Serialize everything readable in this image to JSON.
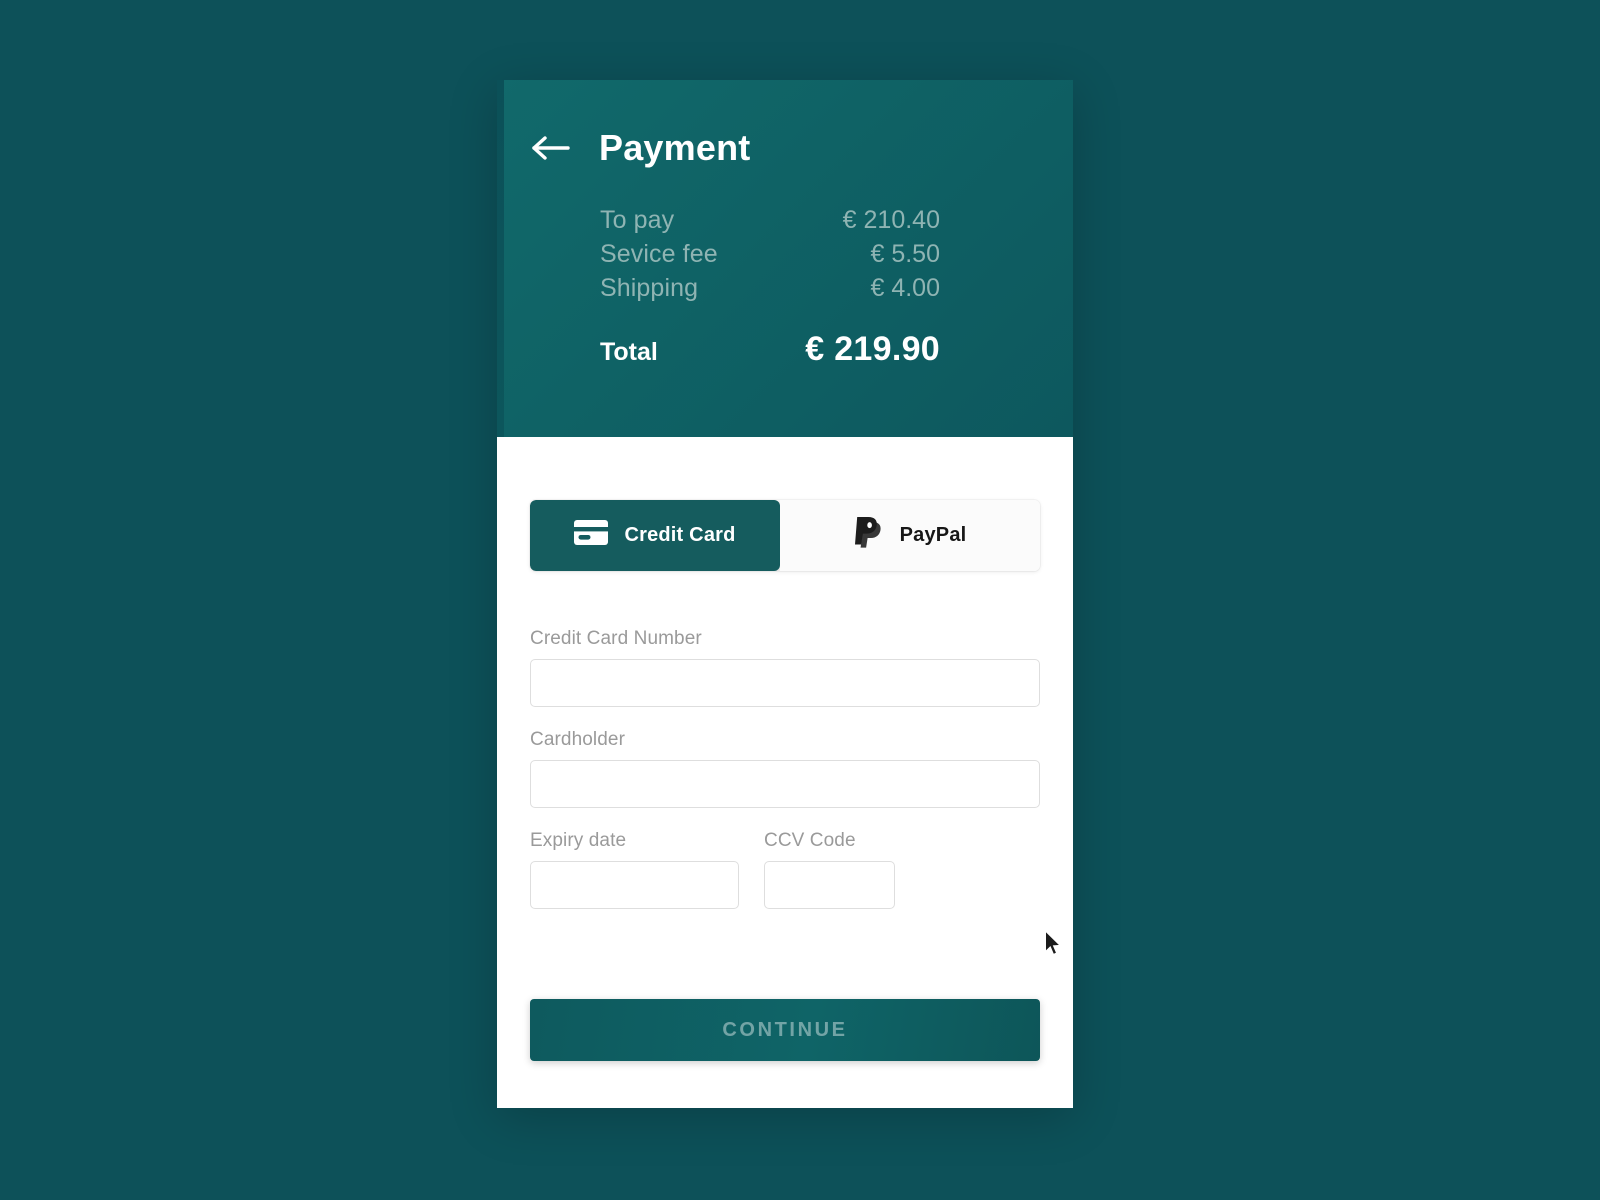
{
  "header": {
    "back_icon": "back-arrow-icon",
    "title": "Payment",
    "line_items": [
      {
        "label": "To pay",
        "value": "€ 210.40"
      },
      {
        "label": "Sevice fee",
        "value": "€ 5.50"
      },
      {
        "label": "Shipping",
        "value": "€ 4.00"
      }
    ],
    "total": {
      "label": "Total",
      "value": "€ 219.90"
    }
  },
  "payment_methods": {
    "tabs": [
      {
        "label": "Credit Card",
        "icon": "credit-card-icon",
        "active": true
      },
      {
        "label": "PayPal",
        "icon": "paypal-icon",
        "active": false
      }
    ]
  },
  "form": {
    "card_number": {
      "label": "Credit Card Number",
      "value": "",
      "placeholder": ""
    },
    "cardholder": {
      "label": "Cardholder",
      "value": "",
      "placeholder": ""
    },
    "expiry": {
      "label": "Expiry date",
      "value": "",
      "placeholder": ""
    },
    "ccv": {
      "label": "CCV Code",
      "value": "",
      "placeholder": ""
    }
  },
  "actions": {
    "continue_label": "CONTINUE"
  },
  "colors": {
    "page_background": "#0d5159",
    "header_teal": "#0f6265",
    "active_tab": "#155c5e",
    "muted_text": "#8fb4b3",
    "label_text": "#9a9a9a",
    "input_border": "#dedede",
    "panel_white": "#ffffff"
  }
}
